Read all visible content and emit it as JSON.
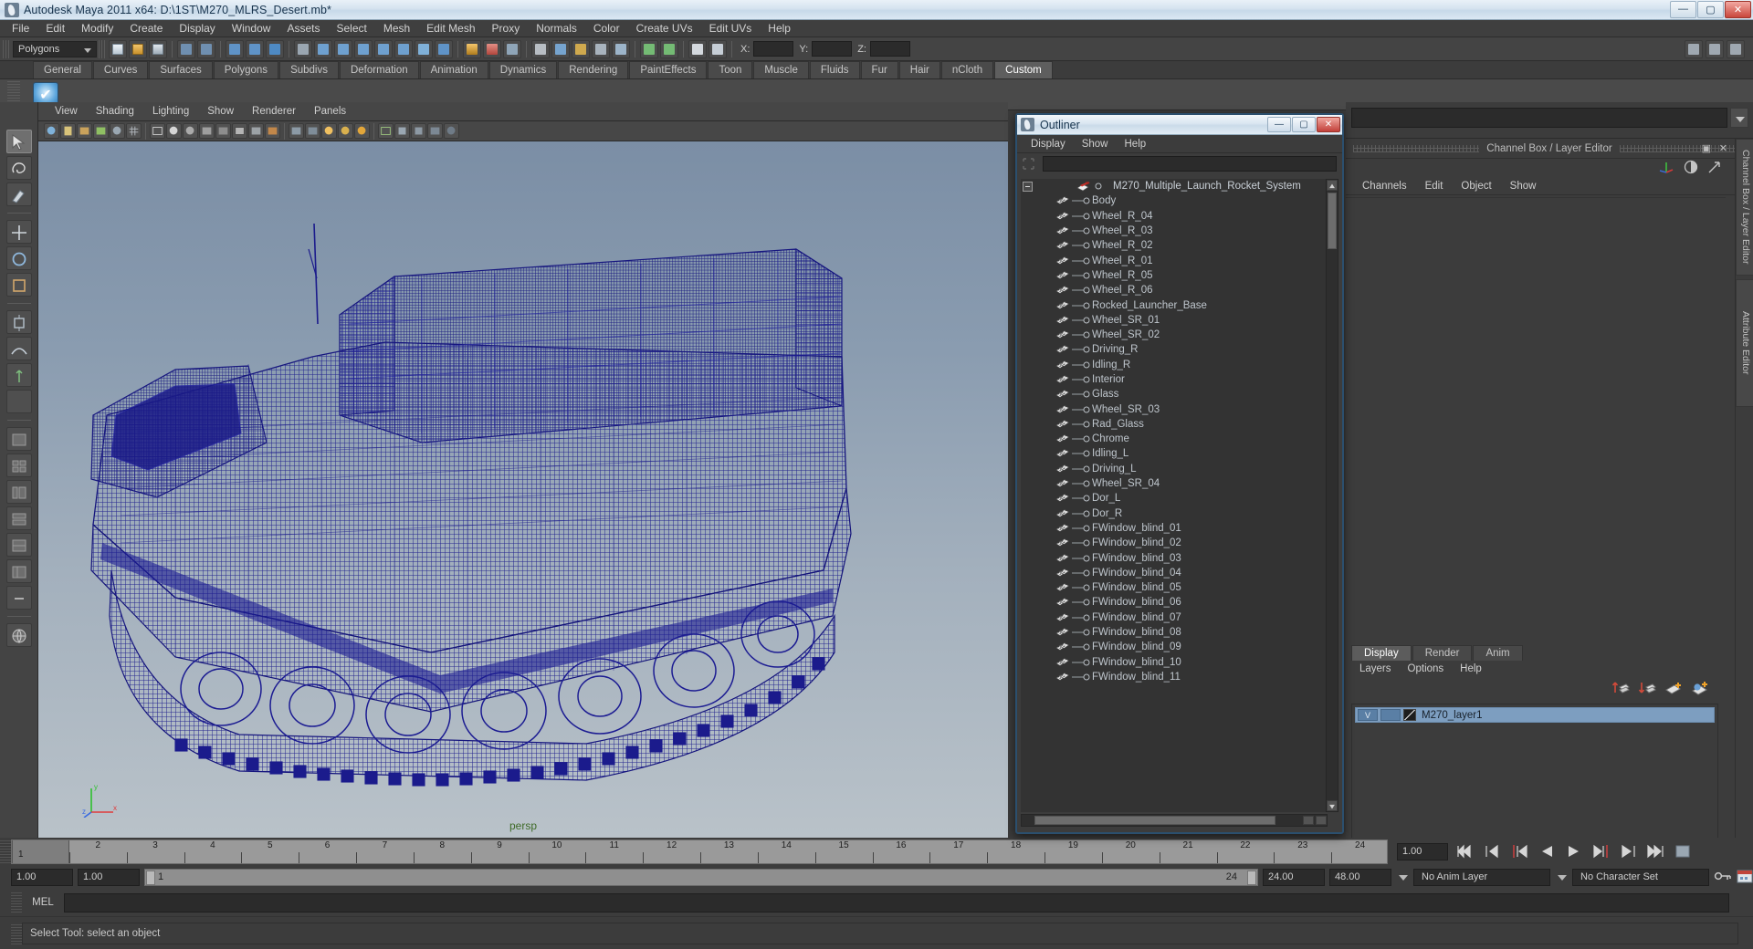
{
  "window": {
    "title": "Autodesk Maya 2011 x64: D:\\1ST\\M270_MLRS_Desert.mb*",
    "minimize": "—",
    "maximize": "▢",
    "close": "✕"
  },
  "menubar": {
    "items": [
      "File",
      "Edit",
      "Modify",
      "Create",
      "Display",
      "Window",
      "Assets",
      "Select",
      "Mesh",
      "Edit Mesh",
      "Proxy",
      "Normals",
      "Color",
      "Create UVs",
      "Edit UVs",
      "Help"
    ]
  },
  "statusline": {
    "mode": "Polygons",
    "axis_x_label": "X:",
    "axis_y_label": "Y:",
    "axis_z_label": "Z:",
    "axis_x_value": "",
    "axis_y_value": "",
    "axis_z_value": ""
  },
  "shelf": {
    "tabs": [
      "General",
      "Curves",
      "Surfaces",
      "Polygons",
      "Subdivs",
      "Deformation",
      "Animation",
      "Dynamics",
      "Rendering",
      "PaintEffects",
      "Toon",
      "Muscle",
      "Fluids",
      "Fur",
      "Hair",
      "nCloth",
      "Custom"
    ],
    "active_tab": "Custom"
  },
  "viewport": {
    "menu": [
      "View",
      "Shading",
      "Lighting",
      "Show",
      "Renderer",
      "Panels"
    ],
    "camera_label": "persp",
    "axis_x": "x",
    "axis_y": "y",
    "axis_z": "z"
  },
  "outliner": {
    "title": "Outliner",
    "menu": [
      "Display",
      "Show",
      "Help"
    ],
    "search_value": "",
    "minimize": "—",
    "maximize": "▢",
    "close": "✕",
    "items": [
      {
        "label": "M270_Multiple_Launch_Rocket_System",
        "type": "root",
        "expanded": true
      },
      {
        "label": "Body",
        "type": "mesh"
      },
      {
        "label": "Wheel_R_04",
        "type": "mesh"
      },
      {
        "label": "Wheel_R_03",
        "type": "mesh"
      },
      {
        "label": "Wheel_R_02",
        "type": "mesh"
      },
      {
        "label": "Wheel_R_01",
        "type": "mesh"
      },
      {
        "label": "Wheel_R_05",
        "type": "mesh"
      },
      {
        "label": "Wheel_R_06",
        "type": "mesh"
      },
      {
        "label": "Rocked_Launcher_Base",
        "type": "mesh"
      },
      {
        "label": "Wheel_SR_01",
        "type": "mesh"
      },
      {
        "label": "Wheel_SR_02",
        "type": "mesh"
      },
      {
        "label": "Driving_R",
        "type": "mesh"
      },
      {
        "label": "Idling_R",
        "type": "mesh"
      },
      {
        "label": "Interior",
        "type": "mesh"
      },
      {
        "label": "Glass",
        "type": "mesh"
      },
      {
        "label": "Wheel_SR_03",
        "type": "mesh"
      },
      {
        "label": "Rad_Glass",
        "type": "mesh"
      },
      {
        "label": "Chrome",
        "type": "mesh"
      },
      {
        "label": "Idling_L",
        "type": "mesh"
      },
      {
        "label": "Driving_L",
        "type": "mesh"
      },
      {
        "label": "Wheel_SR_04",
        "type": "mesh"
      },
      {
        "label": "Dor_L",
        "type": "mesh"
      },
      {
        "label": "Dor_R",
        "type": "mesh"
      },
      {
        "label": "FWindow_blind_01",
        "type": "mesh"
      },
      {
        "label": "FWindow_blind_02",
        "type": "mesh"
      },
      {
        "label": "FWindow_blind_03",
        "type": "mesh"
      },
      {
        "label": "FWindow_blind_04",
        "type": "mesh"
      },
      {
        "label": "FWindow_blind_05",
        "type": "mesh"
      },
      {
        "label": "FWindow_blind_06",
        "type": "mesh"
      },
      {
        "label": "FWindow_blind_07",
        "type": "mesh"
      },
      {
        "label": "FWindow_blind_08",
        "type": "mesh"
      },
      {
        "label": "FWindow_blind_09",
        "type": "mesh"
      },
      {
        "label": "FWindow_blind_10",
        "type": "mesh"
      },
      {
        "label": "FWindow_blind_11",
        "type": "mesh"
      }
    ]
  },
  "channelbox": {
    "header": "Channel Box / Layer Editor",
    "menu": [
      "Channels",
      "Edit",
      "Object",
      "Show"
    ],
    "restore_icon": "▣",
    "close_icon": "✕"
  },
  "sidetabs": [
    "Channel Box / Layer Editor",
    "Attribute Editor"
  ],
  "layer_editor": {
    "tabs": [
      "Display",
      "Render",
      "Anim"
    ],
    "active_tab": "Display",
    "menu": [
      "Layers",
      "Options",
      "Help"
    ],
    "layers": [
      {
        "visibility": "V",
        "state": "",
        "name": "M270_layer1",
        "selected": true
      }
    ]
  },
  "timeline": {
    "ticks": [
      "1",
      "2",
      "3",
      "4",
      "5",
      "6",
      "7",
      "8",
      "9",
      "10",
      "11",
      "12",
      "13",
      "14",
      "15",
      "16",
      "17",
      "18",
      "19",
      "20",
      "21",
      "22",
      "23",
      "24"
    ],
    "current_frame_marker": "1",
    "current_frame_field": "1.00"
  },
  "range": {
    "start_field": "1.00",
    "start_field2": "1.00",
    "slider_start": "1",
    "slider_end": "24",
    "end_field": "24.00",
    "max_field": "48.00",
    "anim_layer": "No Anim Layer",
    "character_set": "No Character Set"
  },
  "mel": {
    "label": "MEL",
    "value": "",
    "placeholder": ""
  },
  "helpline": {
    "text": "Select Tool: select an object"
  },
  "colors": {
    "accent_blue": "#1b1b8c",
    "viewport_sky": "#7b8ea5",
    "selection_blue": "#7d9ec0",
    "close_red": "#c2403a"
  }
}
